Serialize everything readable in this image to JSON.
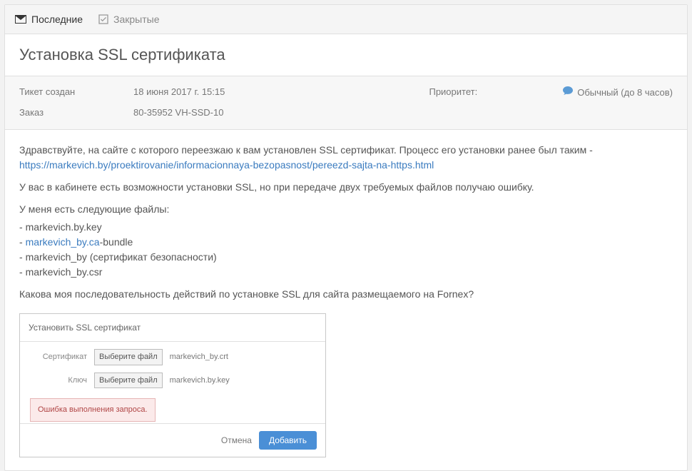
{
  "tabs": {
    "recent": "Последние",
    "closed": "Закрытые"
  },
  "page_title": "Установка SSL сертификата",
  "meta": {
    "created_label": "Тикет создан",
    "created_value": "18 июня 2017 г. 15:15",
    "order_label": "Заказ",
    "order_value": "80-35952 VH-SSD-10",
    "priority_label": "Приоритет:",
    "priority_value": "Обычный (до 8 часов)"
  },
  "message": {
    "intro": "Здравствуйте, на сайте с которого переезжаю к вам установлен SSL сертификат. Процесс его установки ранее был таким - ",
    "link": "https://markevich.by/proektirovanie/informacionnaya-bezopasnost/pereezd-sajta-na-https.html",
    "line2": "У вас в кабинете есть возможности установки SSL, но при передаче двух требуемых файлов получаю ошибку.",
    "files_intro": "У меня есть следующие файлы:",
    "files": [
      {
        "prefix": "- ",
        "name": "markevich.by.key",
        "link": false,
        "suffix": ""
      },
      {
        "prefix": "- ",
        "name": "markevich_by.ca",
        "link": true,
        "suffix": "-bundle"
      },
      {
        "prefix": "- ",
        "name": "markevich_by (сертификат безопасности)",
        "link": false,
        "suffix": ""
      },
      {
        "prefix": "- ",
        "name": "markevich_by.csr",
        "link": false,
        "suffix": ""
      }
    ],
    "question": "Какова моя последовательность действий по установке SSL для сайта размещаемого на Fornex?"
  },
  "modal": {
    "title": "Установить SSL сертификат",
    "cert_label": "Сертификат",
    "key_label": "Ключ",
    "choose_file": "Выберите файл",
    "cert_file": "markevich_by.crt",
    "key_file": "markevich.by.key",
    "error": "Ошибка выполнения запроса.",
    "cancel": "Отмена",
    "submit": "Добавить"
  }
}
